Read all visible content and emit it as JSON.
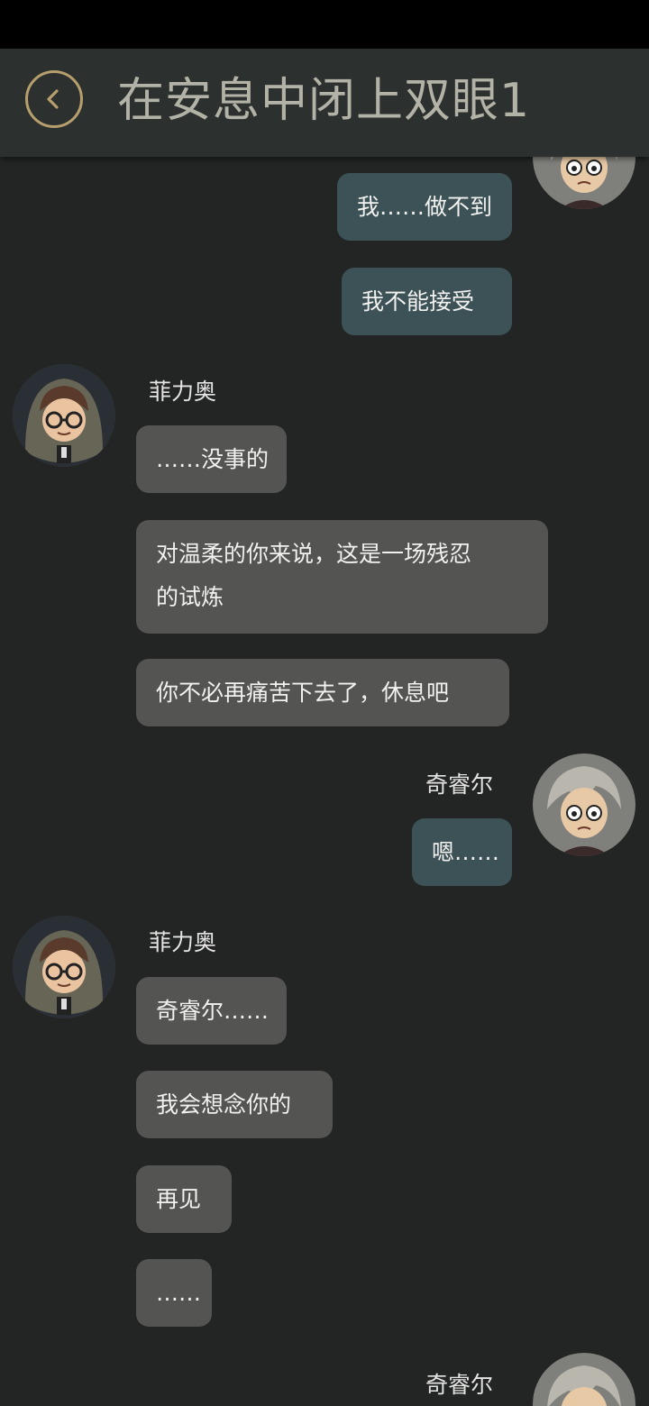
{
  "header": {
    "title": "在安息中闭上双眼1"
  },
  "characters": {
    "left_name": "菲力奥",
    "right_name": "奇睿尔"
  },
  "messages": [
    {
      "side": "right",
      "text": "我……做不到"
    },
    {
      "side": "right",
      "text": "我不能接受"
    },
    {
      "side": "left",
      "text": "……没事的"
    },
    {
      "side": "left",
      "line1": "对温柔的你来说，这是一场残忍",
      "line2": "的试炼"
    },
    {
      "side": "left",
      "text": "你不必再痛苦下去了，休息吧"
    },
    {
      "side": "right",
      "text": "嗯……"
    },
    {
      "side": "left",
      "text": "奇睿尔……"
    },
    {
      "side": "left",
      "text": "我会想念你的"
    },
    {
      "side": "left",
      "text": "再见"
    },
    {
      "side": "left",
      "text": "……"
    }
  ],
  "colors": {
    "right_bubble": "#3d5256",
    "left_bubble": "#545453",
    "accent": "#b79e6d"
  }
}
